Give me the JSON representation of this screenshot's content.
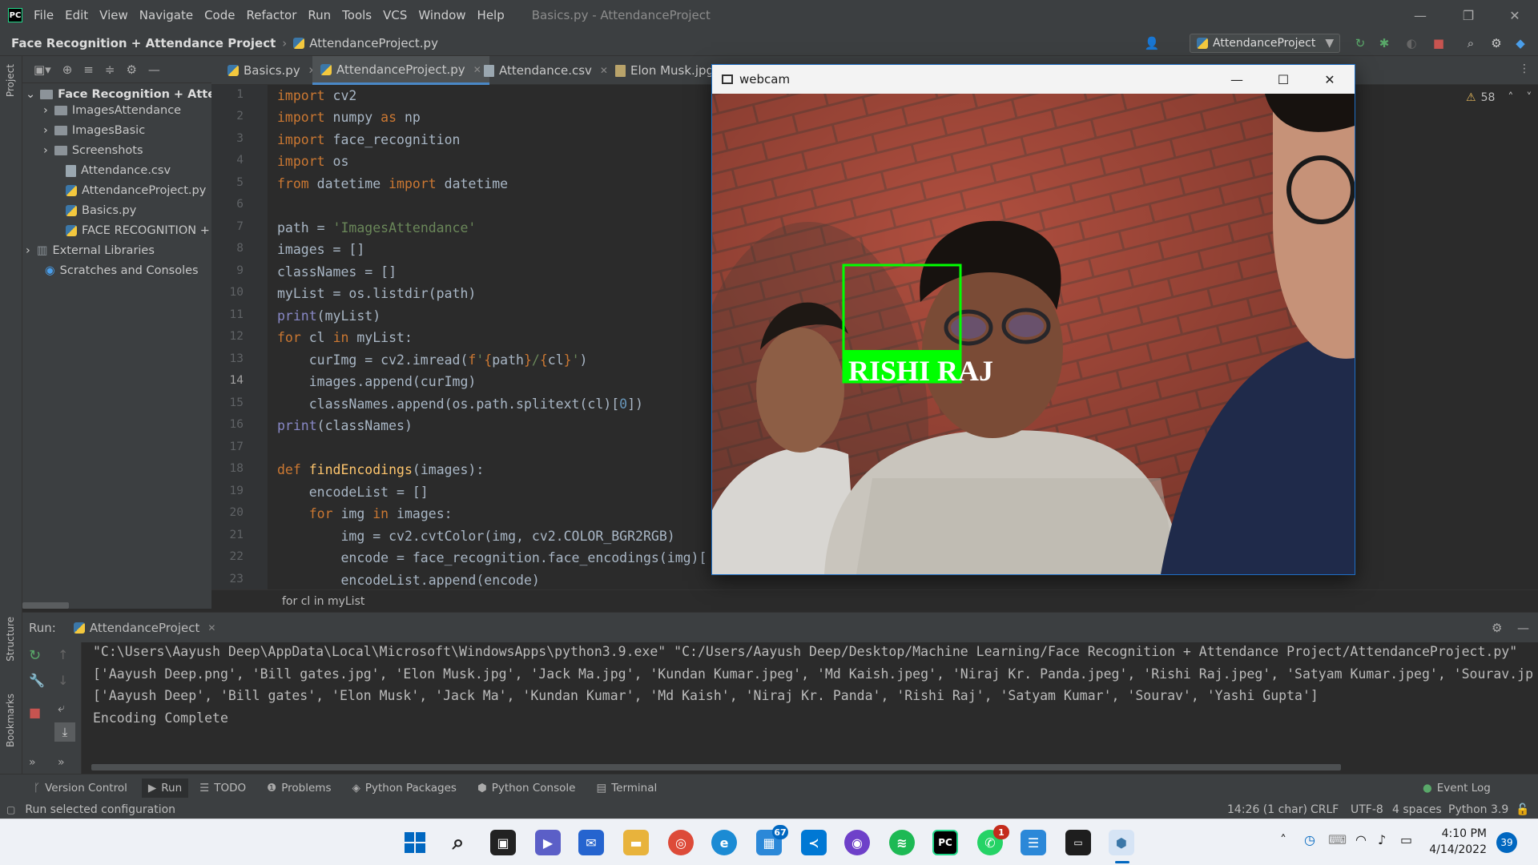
{
  "app": {
    "menu": [
      "File",
      "Edit",
      "View",
      "Navigate",
      "Code",
      "Refactor",
      "Run",
      "Tools",
      "VCS",
      "Window",
      "Help"
    ],
    "window_title": "Basics.py - AttendanceProject"
  },
  "nav": {
    "project": "Face Recognition + Attendance Project",
    "file": "AttendanceProject.py",
    "run_config": "AttendanceProject"
  },
  "sidebar": {
    "strip_labels": [
      "Project",
      "Structure",
      "Bookmarks"
    ],
    "tree": [
      {
        "label": "Face Recognition + Attenc",
        "type": "folder",
        "depth": 0,
        "expanded": true
      },
      {
        "label": "ImagesAttendance",
        "type": "folder",
        "depth": 1
      },
      {
        "label": "ImagesBasic",
        "type": "folder",
        "depth": 1
      },
      {
        "label": "Screenshots",
        "type": "folder",
        "depth": 1
      },
      {
        "label": "Attendance.csv",
        "type": "csv",
        "depth": 1
      },
      {
        "label": "AttendanceProject.py",
        "type": "py",
        "depth": 1
      },
      {
        "label": "Basics.py",
        "type": "py",
        "depth": 1
      },
      {
        "label": "FACE RECOGNITION + A",
        "type": "py",
        "depth": 1
      },
      {
        "label": "External Libraries",
        "type": "lib",
        "depth": 0
      },
      {
        "label": "Scratches and Consoles",
        "type": "scratch",
        "depth": 0
      }
    ]
  },
  "tabs": [
    {
      "label": "Basics.py",
      "active": false
    },
    {
      "label": "AttendanceProject.py",
      "active": true
    },
    {
      "label": "Attendance.csv",
      "active": false
    },
    {
      "label": "Elon Musk.jpg",
      "active": false
    }
  ],
  "editor": {
    "warnings": "58",
    "current_line": 14,
    "lines": [
      {
        "n": "1"
      },
      {
        "n": "2"
      },
      {
        "n": "3"
      },
      {
        "n": "4"
      },
      {
        "n": "5"
      },
      {
        "n": "6"
      },
      {
        "n": "7"
      },
      {
        "n": "8"
      },
      {
        "n": "9"
      },
      {
        "n": "10"
      },
      {
        "n": "11"
      },
      {
        "n": "12"
      },
      {
        "n": "13"
      },
      {
        "n": "14"
      },
      {
        "n": "15"
      },
      {
        "n": "16"
      },
      {
        "n": "17"
      },
      {
        "n": "18"
      },
      {
        "n": "19"
      },
      {
        "n": "20"
      },
      {
        "n": "21"
      },
      {
        "n": "22"
      },
      {
        "n": "23"
      }
    ],
    "breadcrumb": "for cl in myList"
  },
  "webcam": {
    "title": "webcam",
    "detected_name": "RISHI RAJ",
    "box_color": "#00ff00"
  },
  "run": {
    "label": "Run:",
    "tab": "AttendanceProject",
    "output": [
      "\"C:\\Users\\Aayush Deep\\AppData\\Local\\Microsoft\\WindowsApps\\python3.9.exe\" \"C:/Users/Aayush Deep/Desktop/Machine Learning/Face Recognition + Attendance Project/AttendanceProject.py\"",
      "['Aayush Deep.png', 'Bill gates.jpg', 'Elon Musk.jpg', 'Jack Ma.jpg', 'Kundan Kumar.jpeg', 'Md Kaish.jpeg', 'Niraj Kr. Panda.jpeg', 'Rishi Raj.jpeg', 'Satyam Kumar.jpeg', 'Sourav.jp",
      "['Aayush Deep', 'Bill gates', 'Elon Musk', 'Jack Ma', 'Kundan Kumar', 'Md Kaish', 'Niraj Kr. Panda', 'Rishi Raj', 'Satyam Kumar', 'Sourav', 'Yashi Gupta']",
      "Encoding Complete"
    ]
  },
  "tool_windows": [
    "Version Control",
    "Run",
    "TODO",
    "Problems",
    "Python Packages",
    "Python Console",
    "Terminal",
    "Event Log"
  ],
  "status": {
    "message": "Run selected configuration",
    "position": "14:26 (1 char)",
    "line_sep": "CRLF",
    "encoding": "UTF-8",
    "indent": "4 spaces",
    "interpreter": "Python 3.9"
  },
  "taskbar": {
    "time": "4:10 PM",
    "date": "4/14/2022",
    "notif_count": "39",
    "badge_67": "67",
    "badge_1": "1",
    "colors": {
      "accent": "#0067c0",
      "pycharm": "#21d789"
    }
  }
}
